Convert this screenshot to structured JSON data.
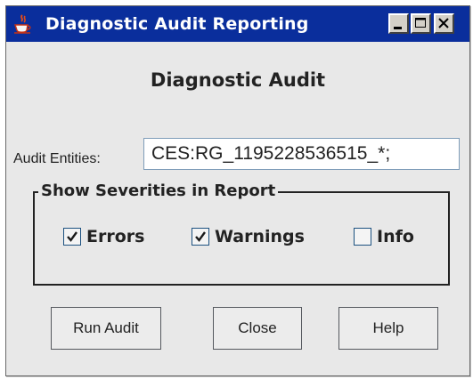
{
  "window": {
    "title": "Diagnostic Audit Reporting",
    "icon": "java-cup-icon",
    "controls": [
      "minimize-icon",
      "maximize-icon",
      "close-icon"
    ]
  },
  "heading": "Diagnostic Audit",
  "audit_entities": {
    "label": "Audit Entities:",
    "value": "CES:RG_1195228536515_*;"
  },
  "severities": {
    "group_title": "Show Severities in Report",
    "options": [
      {
        "label": "Errors",
        "checked": true
      },
      {
        "label": "Warnings",
        "checked": true
      },
      {
        "label": "Info",
        "checked": false
      }
    ]
  },
  "buttons": {
    "run_audit": "Run Audit",
    "close": "Close",
    "help": "Help"
  },
  "colors": {
    "titlebar": "#0a2e9c",
    "window_bg": "#e8e8e8"
  }
}
